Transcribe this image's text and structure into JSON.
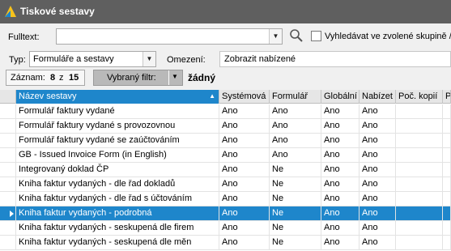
{
  "window": {
    "title": "Tiskové sestavy"
  },
  "search": {
    "fulltext_label": "Fulltext:",
    "value": "",
    "option_label": "Vyhledávat ve zvolené skupině /"
  },
  "filters": {
    "type_label": "Typ:",
    "type_value": "Formuláře a sestavy",
    "restriction_label": "Omezení:",
    "restriction_value": "Zobrazit nabízené"
  },
  "records": {
    "label": "Záznam:",
    "current": "8",
    "of": "z",
    "total": "15"
  },
  "selected_filter": {
    "button_label": "Vybraný filtr:",
    "value": "žádný"
  },
  "grid": {
    "columns": [
      "Název sestavy",
      "Systémová",
      "Formulář",
      "Globální",
      "Nabízet",
      "Poč. kopií",
      "P"
    ],
    "rows": [
      {
        "name": "Formulář faktury vydané",
        "system": "Ano",
        "form": "Ano",
        "global": "Ano",
        "offer": "Ano"
      },
      {
        "name": "Formulář faktury vydané s provozovnou",
        "system": "Ano",
        "form": "Ano",
        "global": "Ano",
        "offer": "Ano"
      },
      {
        "name": "Formulář faktury vydané se zaúčtováním",
        "system": "Ano",
        "form": "Ano",
        "global": "Ano",
        "offer": "Ano"
      },
      {
        "name": "GB - Issued Invoice Form (in English)",
        "system": "Ano",
        "form": "Ano",
        "global": "Ano",
        "offer": "Ano"
      },
      {
        "name": "Integrovaný doklad ČP",
        "system": "Ano",
        "form": "Ne",
        "global": "Ano",
        "offer": "Ano"
      },
      {
        "name": "Kniha faktur vydaných - dle řad dokladů",
        "system": "Ano",
        "form": "Ne",
        "global": "Ano",
        "offer": "Ano"
      },
      {
        "name": "Kniha faktur vydaných - dle řad s účtováním",
        "system": "Ano",
        "form": "Ne",
        "global": "Ano",
        "offer": "Ano"
      },
      {
        "name": "Kniha faktur vydaných - podrobná",
        "system": "Ano",
        "form": "Ne",
        "global": "Ano",
        "offer": "Ano"
      },
      {
        "name": "Kniha faktur vydaných - seskupená dle firem",
        "system": "Ano",
        "form": "Ne",
        "global": "Ano",
        "offer": "Ano"
      },
      {
        "name": "Kniha faktur vydaných - seskupená dle měn",
        "system": "Ano",
        "form": "Ne",
        "global": "Ano",
        "offer": "Ano"
      }
    ]
  }
}
